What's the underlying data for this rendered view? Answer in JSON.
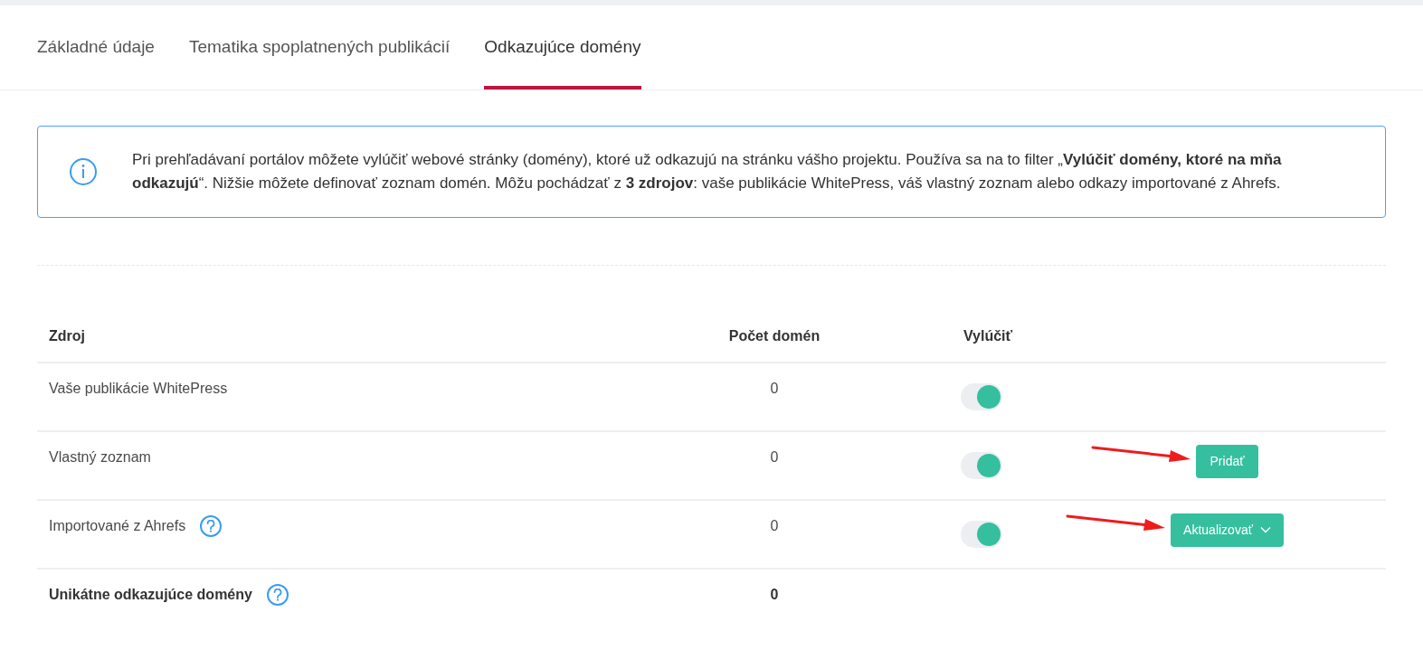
{
  "tabs": [
    {
      "label": "Základné údaje",
      "selected": false
    },
    {
      "label": "Tematika spoplatnených publikácií",
      "selected": false
    },
    {
      "label": "Odkazujúce domény",
      "selected": true
    }
  ],
  "info": {
    "text": "Pri prehľadávaní portálov môžete vylúčiť webové stránky (domény), ktoré už odkazujú na stránku vášho projektu. Používa sa na to filter „**Vylúčiť domény, ktoré na mňa odkazujú**“. Nižšie môžete definovať zoznam domén. Môžu pochádzať z **3 zdrojov**: vaše publikácie WhitePress, váš vlastný zoznam alebo odkazy importované z Ahrefs."
  },
  "table": {
    "columns": [
      "Zdroj",
      "Počet domén",
      "Vylúčiť"
    ],
    "rows": [
      {
        "source": "Vaše publikácie WhitePress",
        "help": false,
        "count": "0",
        "excluded": true
      },
      {
        "source": "Vlastný zoznam",
        "help": false,
        "count": "0",
        "excluded": true,
        "action": {
          "kind": "button",
          "label": "Pridať",
          "annotated": true
        }
      },
      {
        "source": "Importované z Ahrefs",
        "help": true,
        "count": "0",
        "excluded": true,
        "action": {
          "kind": "dropdown",
          "label": "Aktualizovať",
          "annotated": true
        }
      }
    ],
    "total": {
      "label": "Unikátne odkazujúce domény",
      "help": true,
      "count": "0"
    }
  }
}
